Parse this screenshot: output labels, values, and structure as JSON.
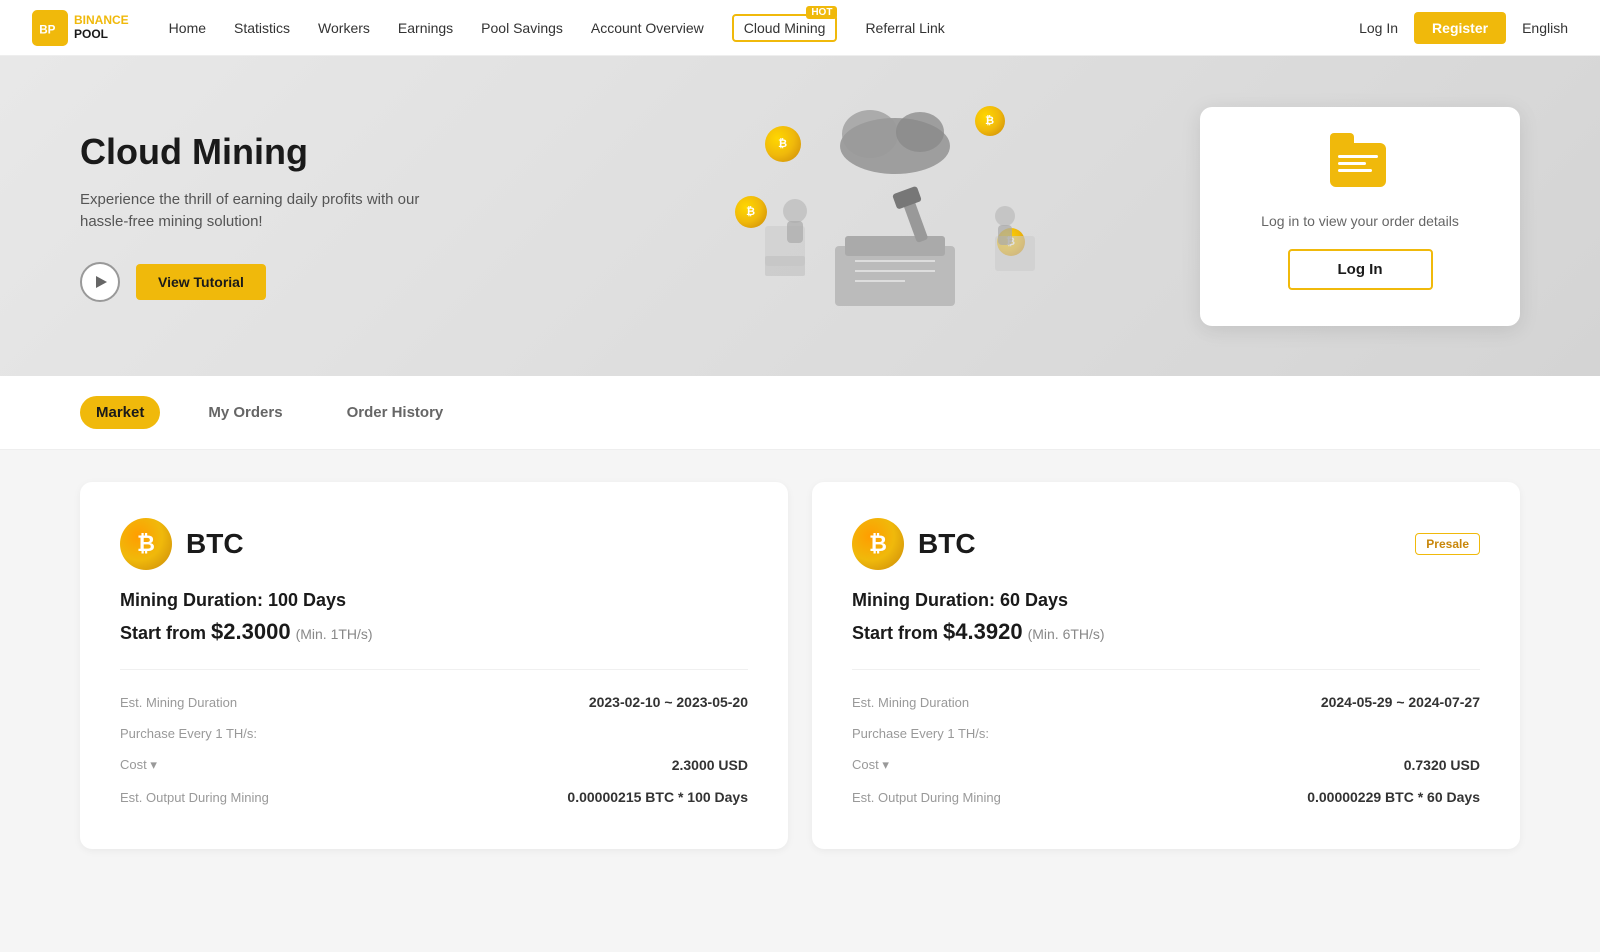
{
  "brand": {
    "logo_text": "BINANCE POOL",
    "logo_line1": "BINANCE",
    "logo_line2": "POOL"
  },
  "nav": {
    "links": [
      {
        "id": "home",
        "label": "Home"
      },
      {
        "id": "statistics",
        "label": "Statistics"
      },
      {
        "id": "workers",
        "label": "Workers"
      },
      {
        "id": "earnings",
        "label": "Earnings"
      },
      {
        "id": "pool-savings",
        "label": "Pool Savings"
      },
      {
        "id": "account-overview",
        "label": "Account Overview"
      },
      {
        "id": "cloud-mining",
        "label": "Cloud Mining"
      },
      {
        "id": "referral-link",
        "label": "Referral Link"
      }
    ],
    "hot_badge": "HOT",
    "login_label": "Log In",
    "register_label": "Register",
    "language": "English"
  },
  "hero": {
    "title": "Cloud Mining",
    "description": "Experience the thrill of earning daily profits with our hassle-free mining solution!",
    "tutorial_button": "View Tutorial",
    "order_card": {
      "text": "Log in to view your order details",
      "login_button": "Log In"
    }
  },
  "tabs": [
    {
      "id": "market",
      "label": "Market",
      "active": true
    },
    {
      "id": "my-orders",
      "label": "My Orders",
      "active": false
    },
    {
      "id": "order-history",
      "label": "Order History",
      "active": false
    }
  ],
  "products": [
    {
      "id": "btc-100",
      "coin": "BTC",
      "coin_symbol": "₿",
      "presale": false,
      "duration_label": "Mining Duration: 100 Days",
      "price_label": "Start from",
      "price_value": "$2.3000",
      "min_label": "(Min. 1TH/s)",
      "details": [
        {
          "label": "Est. Mining Duration",
          "value": "2023-02-10 ~ 2023-05-20",
          "dark": true
        },
        {
          "label": "Purchase Every 1 TH/s:",
          "value": "",
          "dark": false
        },
        {
          "label": "Cost ▾",
          "value": "2.3000 USD",
          "dark": true
        },
        {
          "label": "Est. Output During Mining",
          "value": "0.00000215 BTC * 100 Days",
          "dark": true
        }
      ]
    },
    {
      "id": "btc-60",
      "coin": "BTC",
      "coin_symbol": "₿",
      "presale": true,
      "presale_label": "Presale",
      "duration_label": "Mining Duration: 60 Days",
      "price_label": "Start from",
      "price_value": "$4.3920",
      "min_label": "(Min. 6TH/s)",
      "details": [
        {
          "label": "Est. Mining Duration",
          "value": "2024-05-29 ~ 2024-07-27",
          "dark": true
        },
        {
          "label": "Purchase Every 1 TH/s:",
          "value": "",
          "dark": false
        },
        {
          "label": "Cost ▾",
          "value": "0.7320 USD",
          "dark": true
        },
        {
          "label": "Est. Output During Mining",
          "value": "0.00000229 BTC * 60 Days",
          "dark": true
        }
      ]
    }
  ]
}
